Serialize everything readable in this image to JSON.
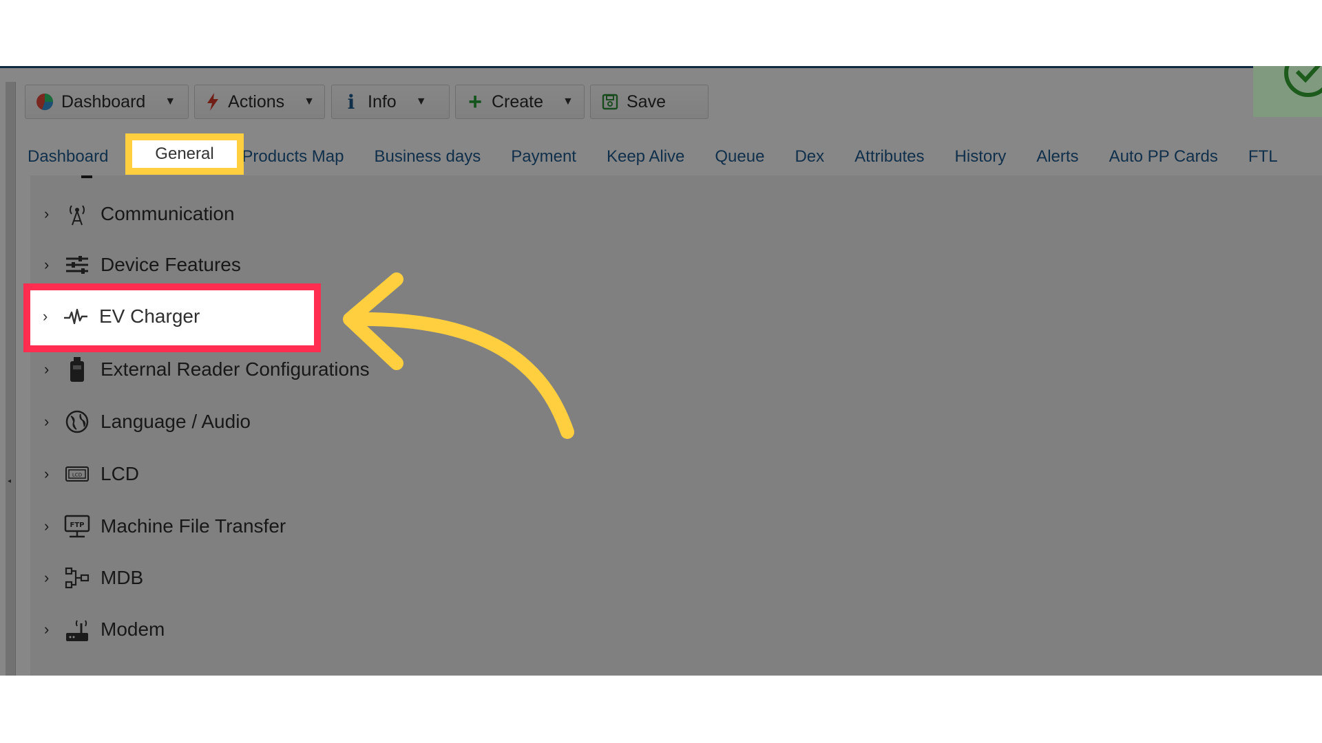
{
  "toolbar": {
    "dashboard_label": "Dashboard",
    "actions_label": "Actions",
    "info_label": "Info",
    "create_label": "Create",
    "save_label": "Save"
  },
  "tabs": [
    {
      "label": "Dashboard"
    },
    {
      "label": "General"
    },
    {
      "label": "Products Map"
    },
    {
      "label": "Business days"
    },
    {
      "label": "Payment"
    },
    {
      "label": "Keep Alive"
    },
    {
      "label": "Queue"
    },
    {
      "label": "Dex"
    },
    {
      "label": "Attributes"
    },
    {
      "label": "History"
    },
    {
      "label": "Alerts"
    },
    {
      "label": "Auto PP Cards"
    },
    {
      "label": "FTL"
    }
  ],
  "tree": [
    {
      "label": "Communication",
      "icon": "antenna-icon"
    },
    {
      "label": "Device Features",
      "icon": "sliders-icon"
    },
    {
      "label": "EV Charger",
      "icon": "pulse-icon"
    },
    {
      "label": "External Reader Configurations",
      "icon": "card-reader-icon"
    },
    {
      "label": "Language / Audio",
      "icon": "globe-icon"
    },
    {
      "label": "LCD",
      "icon": "lcd-icon"
    },
    {
      "label": "Machine File Transfer",
      "icon": "ftp-icon"
    },
    {
      "label": "MDB",
      "icon": "mdb-icon"
    },
    {
      "label": "Modem",
      "icon": "modem-icon"
    }
  ],
  "colors": {
    "highlight_yellow": "#ffcf3f",
    "highlight_red": "#ff2d4f",
    "tab_link": "#1e5a8e"
  }
}
